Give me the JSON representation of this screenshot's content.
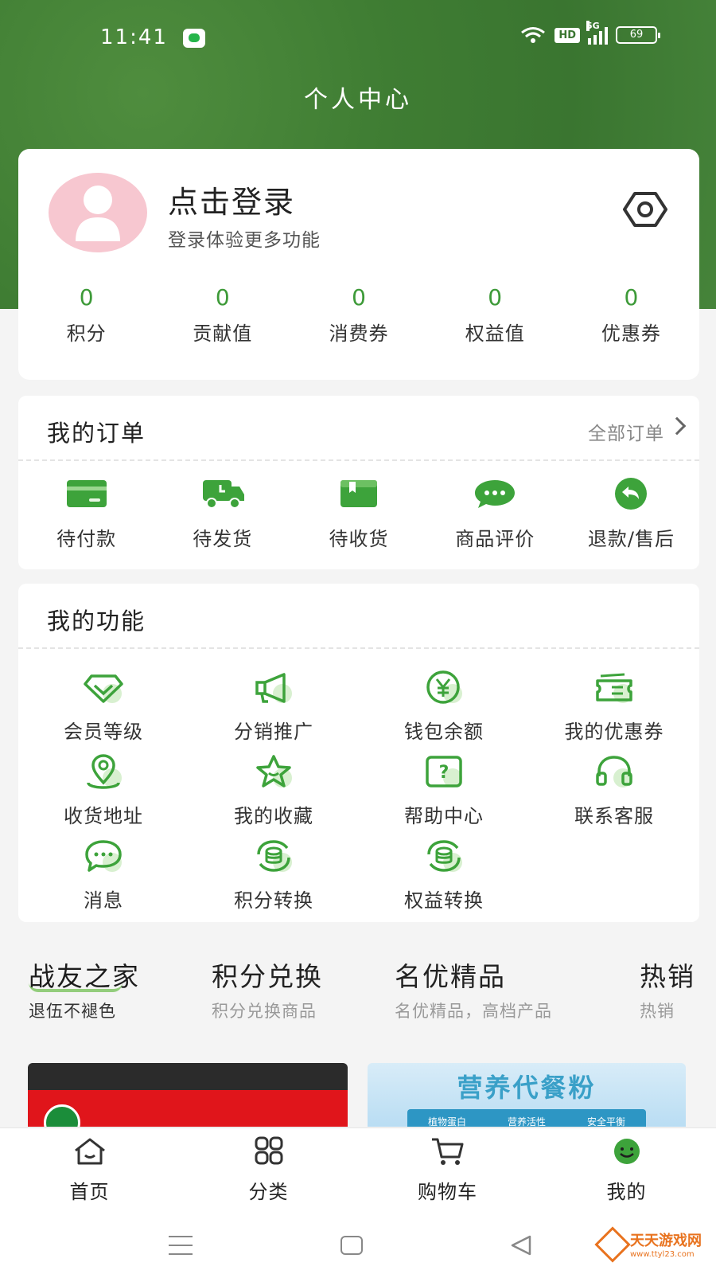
{
  "status_bar": {
    "time": "11:41",
    "hd": "HD",
    "network": "5G",
    "battery": "69"
  },
  "header": {
    "title": "个人中心"
  },
  "profile": {
    "login_title": "点击登录",
    "login_subtitle": "登录体验更多功能",
    "stats": [
      {
        "value": "0",
        "label": "积分"
      },
      {
        "value": "0",
        "label": "贡献值"
      },
      {
        "value": "0",
        "label": "消费券"
      },
      {
        "value": "0",
        "label": "权益值"
      },
      {
        "value": "0",
        "label": "优惠券"
      }
    ]
  },
  "orders": {
    "title": "我的订单",
    "all_link": "全部订单",
    "items": [
      {
        "label": "待付款",
        "icon": "card-icon"
      },
      {
        "label": "待发货",
        "icon": "truck-icon"
      },
      {
        "label": "待收货",
        "icon": "box-icon"
      },
      {
        "label": "商品评价",
        "icon": "chat-icon"
      },
      {
        "label": "退款/售后",
        "icon": "return-icon"
      }
    ]
  },
  "functions": {
    "title": "我的功能",
    "items": [
      {
        "label": "会员等级",
        "icon": "diamond-icon"
      },
      {
        "label": "分销推广",
        "icon": "megaphone-icon"
      },
      {
        "label": "钱包余额",
        "icon": "yen-icon"
      },
      {
        "label": "我的优惠券",
        "icon": "ticket-icon"
      },
      {
        "label": "收货地址",
        "icon": "location-icon"
      },
      {
        "label": "我的收藏",
        "icon": "star-icon"
      },
      {
        "label": "帮助中心",
        "icon": "help-icon"
      },
      {
        "label": "联系客服",
        "icon": "headset-icon"
      },
      {
        "label": "消息",
        "icon": "message-icon"
      },
      {
        "label": "积分转换",
        "icon": "coins-exchange-icon"
      },
      {
        "label": "权益转换",
        "icon": "coins-exchange-icon"
      }
    ]
  },
  "category_tabs": [
    {
      "title": "战友之家",
      "subtitle": "退伍不褪色",
      "active": true
    },
    {
      "title": "积分兑换",
      "subtitle": "积分兑换商品"
    },
    {
      "title": "名优精品",
      "subtitle": "名优精品，高档产品"
    },
    {
      "title": "热销",
      "subtitle": "热销"
    }
  ],
  "banners": {
    "right_title": "营养代餐粉",
    "right_strip": [
      "植物蛋白",
      "营养活性",
      "安全平衡"
    ]
  },
  "tabbar": [
    {
      "label": "首页",
      "icon": "home-icon"
    },
    {
      "label": "分类",
      "icon": "grid-icon"
    },
    {
      "label": "购物车",
      "icon": "cart-icon"
    },
    {
      "label": "我的",
      "icon": "smile-icon",
      "active": true
    }
  ],
  "watermark": {
    "name": "天天游戏网",
    "url": "www.ttyl23.com"
  },
  "colors": {
    "brand_green": "#3d9a38",
    "header_green": "#3f7d33",
    "avatar_pink": "#f7c7d0"
  }
}
